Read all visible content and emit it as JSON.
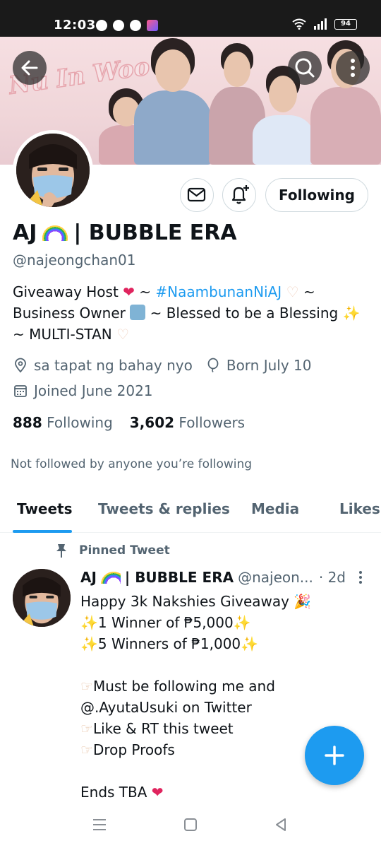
{
  "status_bar": {
    "time": "12:03",
    "battery": "94"
  },
  "banner": {
    "title": "Nu In Woo"
  },
  "profile": {
    "display_name": "AJ",
    "name_suffix": "| BUBBLE ERA",
    "handle": "@najeongchan01",
    "bio": {
      "line1_a": "Giveaway Host",
      "line1_b": "~",
      "hashtag": "#NaambunanNiAJ",
      "line1_c": "~",
      "line2_a": "Business Owner",
      "line2_b": "~ Blessed to be a Blessing",
      "line3": "~ MULTI-STAN"
    },
    "location": "sa tapat ng bahay nyo",
    "birthday": "Born July 10",
    "joined": "Joined June 2021",
    "following_count": "888",
    "following_label": "Following",
    "followers_count": "3,602",
    "followers_label": "Followers",
    "not_followed": "Not followed by anyone you’re following",
    "follow_button": "Following"
  },
  "tabs": [
    "Tweets",
    "Tweets & replies",
    "Media",
    "Likes"
  ],
  "pinned_label": "Pinned Tweet",
  "tweet": {
    "name": "AJ",
    "name_suffix": "| BUBBLE ERA",
    "handle": "@najeon...",
    "date": "· 2d",
    "lines": [
      "Happy 3k Nakshies Giveaway",
      "1 Winner of ₱5,000",
      "5 Winners of ₱1,000",
      "",
      "Must be following me and",
      "@.AyutaUsuki on Twitter",
      "Like & RT this tweet",
      "Drop Proofs",
      "",
      "Ends TBA"
    ]
  },
  "colors": {
    "accent": "#1d9bf0",
    "muted": "#536471",
    "text": "#0f1419"
  }
}
